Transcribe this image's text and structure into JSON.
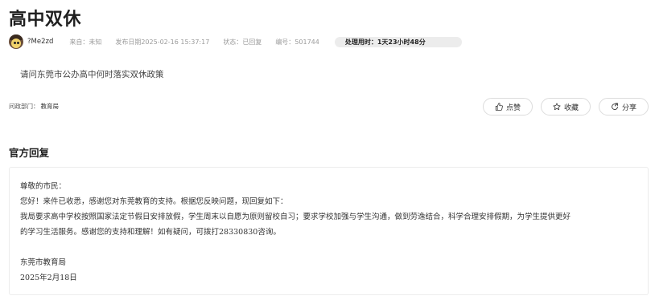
{
  "page": {
    "title": "高中双休"
  },
  "meta": {
    "username": "?Me2zd",
    "source_label": "来自：",
    "source_value": "未知",
    "date_label": "发布日期",
    "date_value": "2025-02-16 15:37:17",
    "status_label": "状态：",
    "status_value": "已回复",
    "number_label": "编号：",
    "number_value": "501744",
    "duration": "处理用时：1天23小时48分"
  },
  "question": {
    "text": "请问东莞市公办高中何时落实双休政策"
  },
  "department": {
    "label": "问政部门：",
    "value": "教育局"
  },
  "actions": {
    "like_label": "点赞",
    "favorite_label": "收藏",
    "share_label": "分享"
  },
  "reply": {
    "section_title": "官方回复",
    "greeting": "尊敬的市民：",
    "line1": "您好！来件已收悉，感谢您对东莞教育的支持。根据您反映问题，现回复如下：",
    "line2": "我局要求高中学校按照国家法定节假日安排放假，学生周末以自愿为原则留校自习；要求学校加强与学生沟通，做到劳逸结合，科学合理安排假期，为学生提供更好",
    "line3": "的学习生活服务。感谢您的支持和理解！如有疑问，可拨打28330830咨询。",
    "signature": "东莞市教育局",
    "date": "2025年2月18日"
  }
}
